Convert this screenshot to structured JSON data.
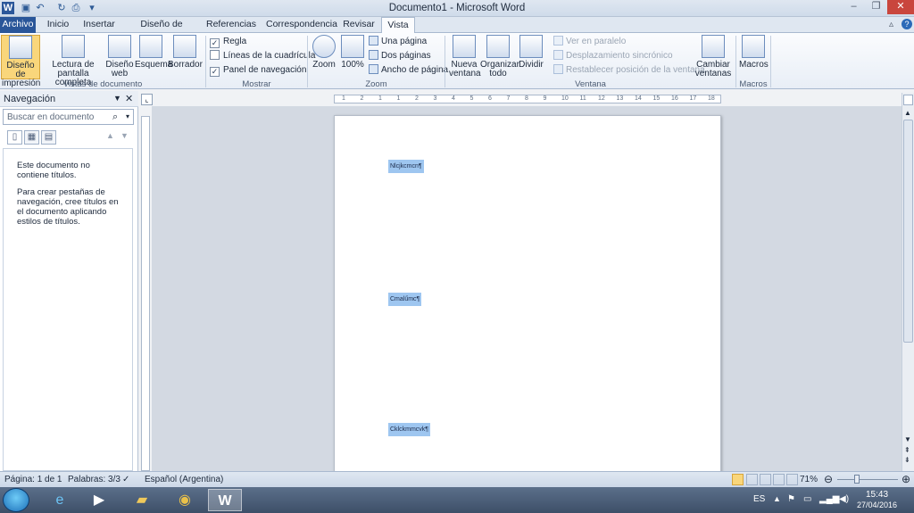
{
  "window": {
    "title": "Documento1 - Microsoft Word"
  },
  "tabs": [
    "Archivo",
    "Inicio",
    "Insertar",
    "Diseño de página",
    "Referencias",
    "Correspondencia",
    "Revisar",
    "Vista"
  ],
  "ribbon": {
    "vistas": {
      "group": "Vistas de documento",
      "buttons": [
        "Diseño de impresión",
        "Lectura de pantalla completa",
        "Diseño web",
        "Esquema",
        "Borrador"
      ]
    },
    "mostrar": {
      "group": "Mostrar",
      "checks": [
        {
          "label": "Regla",
          "checked": true
        },
        {
          "label": "Líneas de la cuadrícula",
          "checked": false
        },
        {
          "label": "Panel de navegación",
          "checked": true
        }
      ]
    },
    "zoom": {
      "group": "Zoom",
      "zoom": "Zoom",
      "pct": "100%",
      "una": "Una página",
      "dos": "Dos páginas",
      "ancho": "Ancho de página"
    },
    "ventana": {
      "group": "Ventana",
      "nueva": "Nueva ventana",
      "organizar": "Organizar todo",
      "dividir": "Dividir",
      "paralelo": "Ver en paralelo",
      "sincronico": "Desplazamiento sincrónico",
      "restablecer": "Restablecer posición de la ventana",
      "cambiar": "Cambiar ventanas"
    },
    "macros": {
      "group": "Macros",
      "button": "Macros"
    }
  },
  "nav": {
    "title": "Navegación",
    "search_placeholder": "Buscar en documento",
    "msg1": "Este documento no contiene títulos.",
    "msg2": "Para crear pestañas de navegación, cree títulos en el documento aplicando estilos de títulos."
  },
  "doc": {
    "paragraphs": [
      "Nlcjkcmcn¶",
      "Cmalűmc¶",
      "Cklckmmcvk¶"
    ]
  },
  "ruler_marks": [
    "1",
    "2",
    "1",
    "1",
    "2",
    "3",
    "4",
    "5",
    "6",
    "7",
    "8",
    "9",
    "10",
    "11",
    "12",
    "13",
    "14",
    "15",
    "16",
    "17",
    "18"
  ],
  "status": {
    "page": "Página: 1 de 1",
    "words": "Palabras: 3/3",
    "lang": "Español (Argentina)",
    "zoom": "71%"
  },
  "tray": {
    "lang": "ES",
    "time": "15:43",
    "date": "27/04/2016"
  }
}
